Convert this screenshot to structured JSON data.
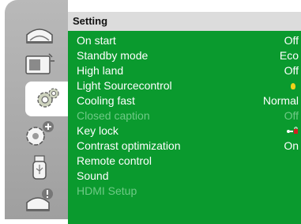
{
  "menu": {
    "title": "Setting",
    "icons": [
      {
        "name": "picture-adjust-icon",
        "selected": false
      },
      {
        "name": "screen-icon",
        "selected": false
      },
      {
        "name": "setting-gear-icon",
        "selected": true
      },
      {
        "name": "expand-gear-icon",
        "selected": false
      },
      {
        "name": "usb-icon",
        "selected": false
      },
      {
        "name": "info-icon",
        "selected": false
      }
    ],
    "items": [
      {
        "label": "On start",
        "value": "Off",
        "enabled": true
      },
      {
        "label": "Standby mode",
        "value": "Eco",
        "enabled": true
      },
      {
        "label": "High land",
        "value": "Off",
        "enabled": true
      },
      {
        "label": "Light Sourcecontrol",
        "value": "",
        "value_icon": "bulb-icon",
        "enabled": true
      },
      {
        "label": "Cooling fast",
        "value": "Normal",
        "enabled": true
      },
      {
        "label": "Closed caption",
        "value": "Off",
        "enabled": false
      },
      {
        "label": "Key lock",
        "value": "",
        "value_icon": "key-lock-icon",
        "enabled": true
      },
      {
        "label": "Contrast optimization",
        "value": "On",
        "enabled": true
      },
      {
        "label": "Remote control",
        "value": "",
        "enabled": true
      },
      {
        "label": "Sound",
        "value": "",
        "enabled": true
      },
      {
        "label": "HDMI Setup",
        "value": "",
        "enabled": false
      }
    ]
  },
  "colors": {
    "panel": "#0a9a2e",
    "title_bar": "#dcdcdc",
    "icon_column": "#aaaaaa",
    "disabled_text": "#6fca86",
    "bulb": "#f2d21a"
  }
}
